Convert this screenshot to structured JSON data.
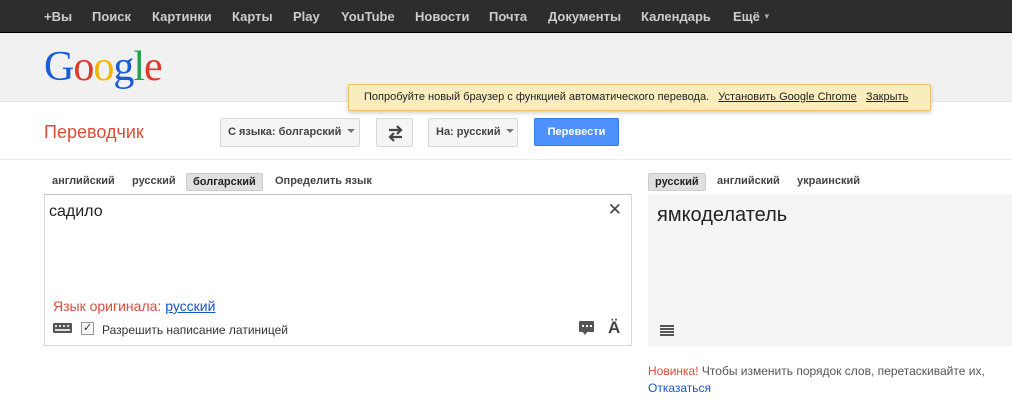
{
  "topbar": {
    "items": [
      {
        "label": "+Вы"
      },
      {
        "label": "Поиск"
      },
      {
        "label": "Картинки"
      },
      {
        "label": "Карты"
      },
      {
        "label": "Play"
      },
      {
        "label": "YouTube"
      },
      {
        "label": "Новости"
      },
      {
        "label": "Почта"
      },
      {
        "label": "Документы"
      },
      {
        "label": "Календарь"
      },
      {
        "label": "Ещё"
      }
    ]
  },
  "logo": {
    "letters": [
      "G",
      "o",
      "o",
      "g",
      "l",
      "e"
    ],
    "colors": [
      "#1a5bd6",
      "#dd3b2a",
      "#f5b400",
      "#1a5bd6",
      "#20a04a",
      "#dd3b2a"
    ]
  },
  "notice": {
    "text": "Попробуйте новый браузер с функцией автоматического перевода.",
    "install_link": "Установить Google Chrome",
    "close_link": "Закрыть"
  },
  "page_title": "Переводчик",
  "from_select": {
    "label": "С языка: болгарский"
  },
  "to_select": {
    "label": "На: русский"
  },
  "translate_button": "Перевести",
  "source": {
    "tabs": [
      {
        "label": "английский",
        "active": false
      },
      {
        "label": "русский",
        "active": false
      },
      {
        "label": "болгарский",
        "active": true
      },
      {
        "label": "Определить язык",
        "active": false
      }
    ],
    "text": "садило",
    "detected_prefix": "Язык оригинала:",
    "detected_lang": "русский",
    "latin_checkbox_label": "Разрешить написание латиницей",
    "latin_checked": true
  },
  "target": {
    "tabs": [
      {
        "label": "русский",
        "active": true
      },
      {
        "label": "английский",
        "active": false
      },
      {
        "label": "украинский",
        "active": false
      }
    ],
    "text": "ямкоделатель"
  },
  "footer_note": {
    "highlight": "Новинка!",
    "text": "Чтобы изменить порядок слов, перетаскивайте их,",
    "refuse_link": "Отказаться"
  },
  "colors": {
    "accent_red": "#dd4b39",
    "button_blue": "#4d90fe",
    "link_blue": "#1155cc"
  }
}
